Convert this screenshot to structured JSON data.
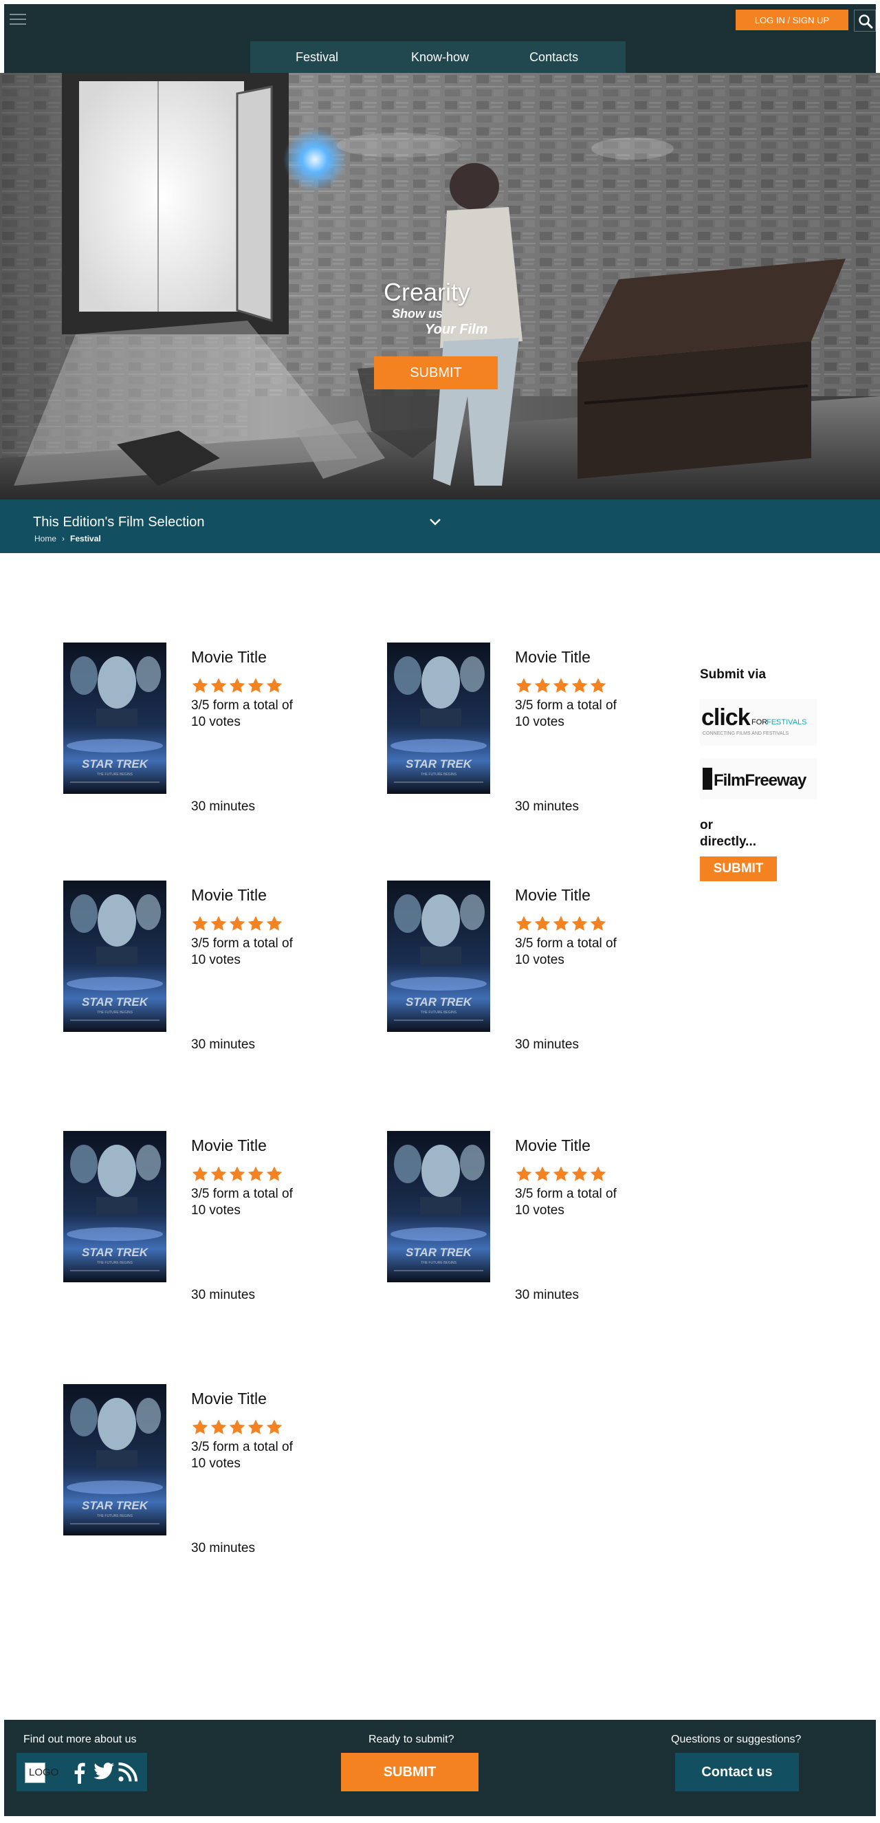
{
  "colors": {
    "accent": "#f58220",
    "dark": "#1a3035",
    "teal": "#124f61",
    "nav_bg": "#21474f",
    "star": "#f58220"
  },
  "header": {
    "menu_icon": "hamburger-menu-icon",
    "login_label": "LOG IN / SIGN UP",
    "search_icon": "search-icon",
    "nav": [
      {
        "label": "Festival"
      },
      {
        "label": "Know-how"
      },
      {
        "label": "Contacts"
      }
    ]
  },
  "hero": {
    "title": "Crearity",
    "subtitle_line1": "Show us",
    "subtitle_line2": "Your Film",
    "submit_label": "SUBMIT"
  },
  "selection_bar": {
    "title": "This Edition's Film Selection",
    "chevron_icon": "chevron-down-icon",
    "breadcrumb": {
      "home": "Home",
      "separator": "›",
      "current": "Festival"
    }
  },
  "films": [
    {
      "title": "Movie Title",
      "stars": 5,
      "votes_text": "3/5 form a total of 10 votes",
      "duration": "30 minutes",
      "poster_title": "STAR TREK",
      "poster_tagline": "THE FUTURE BEGINS"
    },
    {
      "title": "Movie Title",
      "stars": 5,
      "votes_text": "3/5 form a total of 10 votes",
      "duration": "30 minutes",
      "poster_title": "STAR TREK",
      "poster_tagline": "THE FUTURE BEGINS"
    },
    {
      "title": "Movie Title",
      "stars": 5,
      "votes_text": "3/5 form a total of 10 votes",
      "duration": "30 minutes",
      "poster_title": "STAR TREK",
      "poster_tagline": "THE FUTURE BEGINS"
    },
    {
      "title": "Movie Title",
      "stars": 5,
      "votes_text": "3/5 form a total of 10 votes",
      "duration": "30 minutes",
      "poster_title": "STAR TREK",
      "poster_tagline": "THE FUTURE BEGINS"
    },
    {
      "title": "Movie Title",
      "stars": 5,
      "votes_text": "3/5 form a total of 10 votes",
      "duration": "30 minutes",
      "poster_title": "STAR TREK",
      "poster_tagline": "THE FUTURE BEGINS"
    },
    {
      "title": "Movie Title",
      "stars": 5,
      "votes_text": "3/5 form a total of 10 votes",
      "duration": "30 minutes",
      "poster_title": "STAR TREK",
      "poster_tagline": "THE FUTURE BEGINS"
    },
    {
      "title": "Movie Title",
      "stars": 5,
      "votes_text": "3/5 form a total of 10 votes",
      "duration": "30 minutes",
      "poster_title": "STAR TREK",
      "poster_tagline": "THE FUTURE BEGINS"
    }
  ],
  "sidebar": {
    "heading": "Submit via",
    "click_logo_main": "click",
    "click_logo_for": "FOR",
    "click_logo_festivals": "FESTIVALS",
    "click_logo_tagline": "CONNECTING FILMS AND FESTIVALS",
    "filmfreeway_logo": "FilmFreeway",
    "or_line1": "or",
    "or_line2": "directly...",
    "submit_label": "SUBMIT"
  },
  "footer": {
    "col1_heading": "Find out more about us",
    "col2_heading": "Ready to submit?",
    "col3_heading": "Questions or suggestions?",
    "logo_text": "LOGO",
    "social_icons": [
      "facebook-icon",
      "twitter-icon",
      "rss-icon"
    ],
    "submit_label": "SUBMIT",
    "contact_label": "Contact us"
  }
}
